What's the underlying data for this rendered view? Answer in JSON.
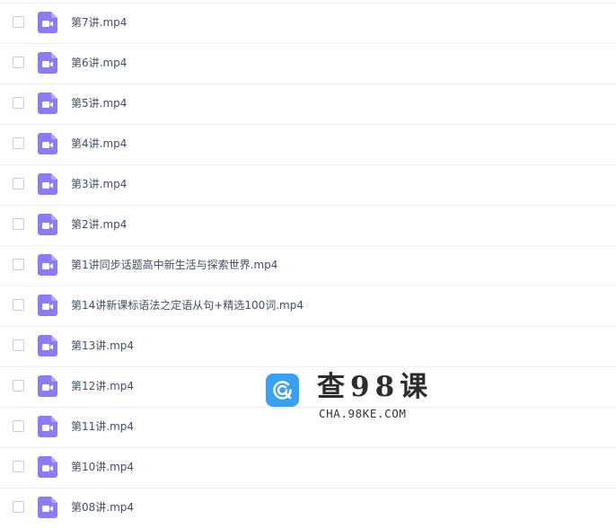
{
  "files": [
    {
      "name": "第7讲.mp4"
    },
    {
      "name": "第6讲.mp4"
    },
    {
      "name": "第5讲.mp4"
    },
    {
      "name": "第4讲.mp4"
    },
    {
      "name": "第3讲.mp4"
    },
    {
      "name": "第2讲.mp4"
    },
    {
      "name": "第1讲同步话题高中新生活与探索世界.mp4"
    },
    {
      "name": "第14讲新课标语法之定语从句+精选100词.mp4"
    },
    {
      "name": "第13讲.mp4"
    },
    {
      "name": "第12讲.mp4"
    },
    {
      "name": "第11讲.mp4"
    },
    {
      "name": "第10讲.mp4"
    },
    {
      "name": "第08讲.mp4"
    }
  ],
  "file_icon": "video-file-icon",
  "colors": {
    "video_icon": "#8b7cf6",
    "text": "#424e67",
    "row_border": "#eef0f3",
    "watermark_logo": "#3aa0f2"
  },
  "watermark": {
    "title": "查98课",
    "subtitle": "CHA.98KE.COM"
  }
}
